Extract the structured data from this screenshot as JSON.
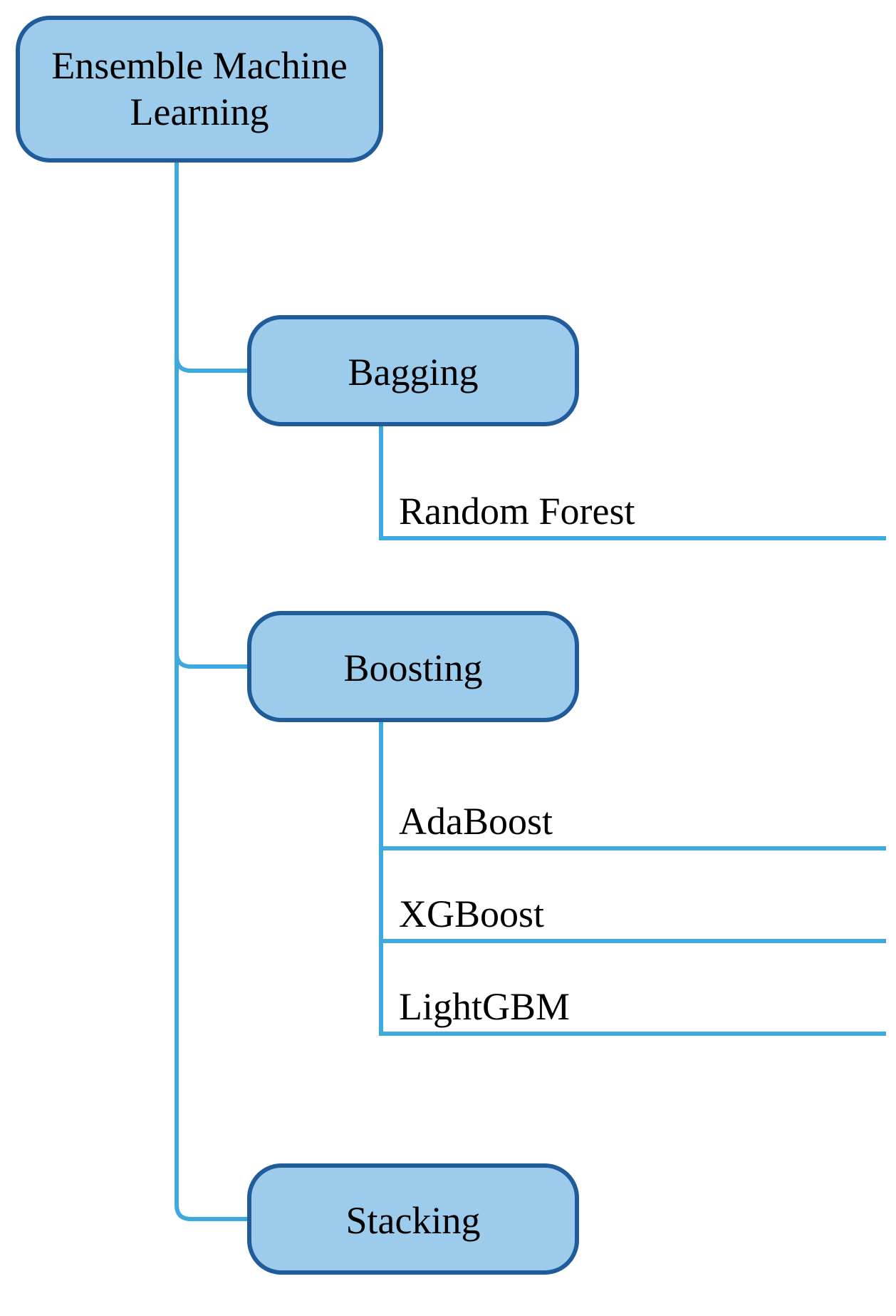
{
  "root": {
    "line1": "Ensemble Machine",
    "line2": "Learning"
  },
  "categories": [
    {
      "label": "Bagging",
      "leaves": [
        "Random Forest"
      ]
    },
    {
      "label": "Boosting",
      "leaves": [
        "AdaBoost",
        "XGBoost",
        "LightGBM"
      ]
    },
    {
      "label": "Stacking",
      "leaves": []
    }
  ]
}
